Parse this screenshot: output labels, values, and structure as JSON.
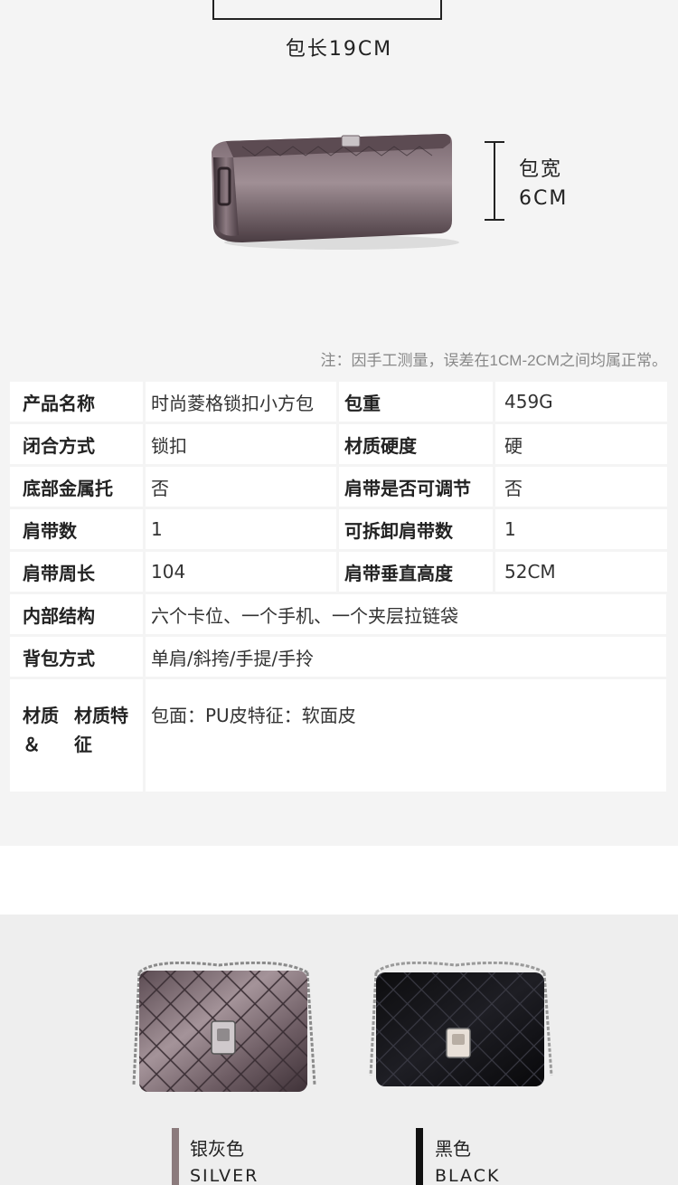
{
  "dimensions": {
    "length_label": "包长19CM",
    "width_label_cn": "包宽",
    "width_label_value": "6CM",
    "note": "注：因手工测量，误差在1CM-2CM之间均属正常。"
  },
  "spec_table": {
    "rows": [
      {
        "k1": "产品名称",
        "v1": "时尚菱格锁扣小方包",
        "k2": "包重",
        "v2": "459G"
      },
      {
        "k1": "闭合方式",
        "v1": "锁扣",
        "k2": "材质硬度",
        "v2": "硬"
      },
      {
        "k1": "底部金属托",
        "v1": "否",
        "k2": "肩带是否可调节",
        "v2": "否"
      },
      {
        "k1": "肩带数",
        "v1": "1",
        "k2": "可拆卸肩带数",
        "v2": "1"
      },
      {
        "k1": "肩带周长",
        "v1": "104",
        "k2": "肩带垂直高度",
        "v2": "52CM"
      }
    ],
    "wide_rows": [
      {
        "k": "内部结构",
        "v": "六个卡位、一个手机、一个夹层拉链袋"
      },
      {
        "k": "背包方式",
        "v": "单肩/斜挎/手提/手拎"
      }
    ],
    "material": {
      "k_line1": "材质＆",
      "k_line2": "材质特征",
      "v_line1": "包面：PU皮",
      "v_line2": "特征：软面皮"
    }
  },
  "colors": [
    {
      "cn": "银灰色",
      "en": "SILVER",
      "swatch": "#8c7b7d"
    },
    {
      "cn": "黑色",
      "en": "BLACK",
      "swatch": "#111111"
    }
  ]
}
